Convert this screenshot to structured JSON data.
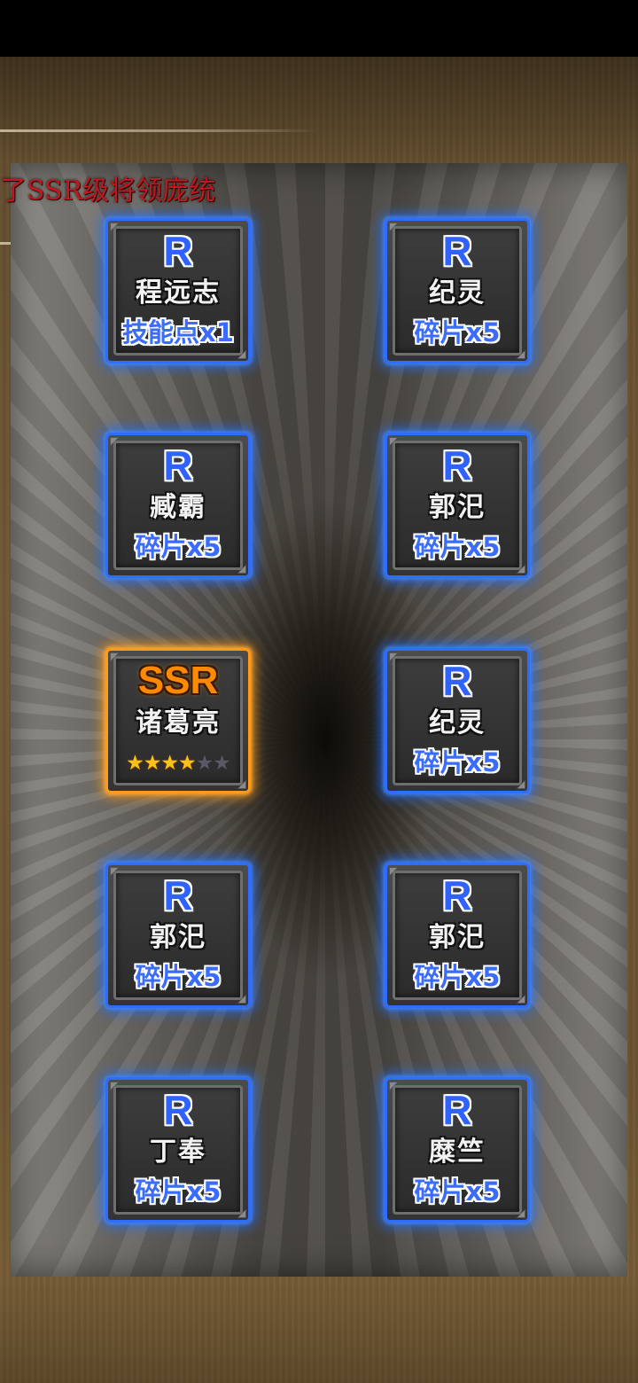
{
  "announcement": "了SSR级将领庞统",
  "cards": [
    {
      "rarity": "R",
      "name": "程远志",
      "reward": "技能点x1"
    },
    {
      "rarity": "R",
      "name": "纪灵",
      "reward": "碎片x5"
    },
    {
      "rarity": "R",
      "name": "臧霸",
      "reward": "碎片x5"
    },
    {
      "rarity": "R",
      "name": "郭汜",
      "reward": "碎片x5"
    },
    {
      "rarity": "SSR",
      "name": "诸葛亮",
      "stars_filled": 4,
      "stars_total": 6
    },
    {
      "rarity": "R",
      "name": "纪灵",
      "reward": "碎片x5"
    },
    {
      "rarity": "R",
      "name": "郭汜",
      "reward": "碎片x5"
    },
    {
      "rarity": "R",
      "name": "郭汜",
      "reward": "碎片x5"
    },
    {
      "rarity": "R",
      "name": "丁奉",
      "reward": "碎片x5"
    },
    {
      "rarity": "R",
      "name": "糜竺",
      "reward": "碎片x5"
    }
  ],
  "colors": {
    "r_glow": "#2f6dff",
    "ssr_glow": "#ff9a1a",
    "announcement": "#c4161c",
    "star_filled": "#ffc21a"
  }
}
